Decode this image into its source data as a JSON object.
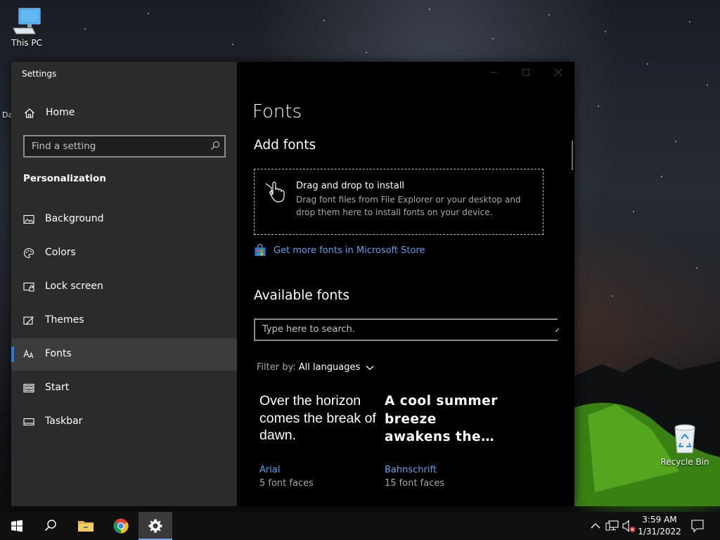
{
  "desktop": {
    "this_pc_label": "This PC",
    "partial_label": "Da",
    "recycle_bin_label": "Recycle Bin"
  },
  "settings": {
    "app_title": "Settings",
    "home_label": "Home",
    "search_placeholder": "Find a setting",
    "section_title": "Personalization",
    "nav_items": [
      {
        "label": "Background",
        "icon": "picture-icon"
      },
      {
        "label": "Colors",
        "icon": "palette-icon"
      },
      {
        "label": "Lock screen",
        "icon": "lock-screen-icon"
      },
      {
        "label": "Themes",
        "icon": "themes-icon"
      },
      {
        "label": "Fonts",
        "icon": "fonts-icon",
        "active": true
      },
      {
        "label": "Start",
        "icon": "start-icon"
      },
      {
        "label": "Taskbar",
        "icon": "taskbar-icon"
      }
    ],
    "accent_color": "#2b7ad9",
    "link_color": "#5aa3ee"
  },
  "fonts_page": {
    "title": "Fonts",
    "add_fonts_heading": "Add fonts",
    "drop_title": "Drag and drop to install",
    "drop_description": "Drag font files from File Explorer or your desktop and drop them here to install fonts on your device.",
    "store_link": "Get more fonts in Microsoft Store",
    "available_heading": "Available fonts",
    "search_placeholder": "Type here to search.",
    "filter_label": "Filter by:",
    "filter_value": "All languages",
    "fonts": [
      {
        "sample": "Over the horizon comes the break of dawn.",
        "name": "Arial",
        "faces": "5 font faces"
      },
      {
        "sample": "A cool summer breeze awakens the…",
        "name": "Bahnschrift",
        "faces": "15 font faces"
      }
    ]
  },
  "taskbar": {
    "time": "3:59 AM",
    "date": "1/31/2022"
  }
}
